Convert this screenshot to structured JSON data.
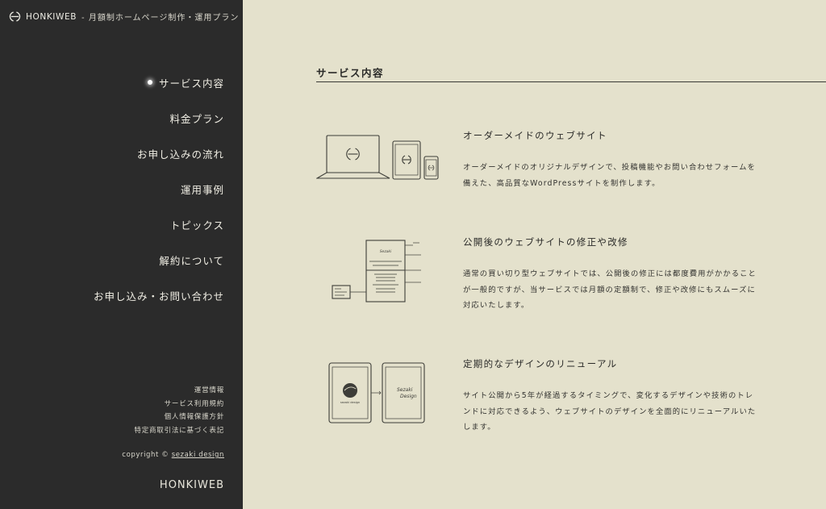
{
  "header": {
    "brand_name": "HONKIWEB",
    "brand_tagline": "- 月額制ホームページ制作・運用プラン"
  },
  "sidebar": {
    "nav": [
      {
        "label": "サービス内容",
        "active": true
      },
      {
        "label": "料金プラン",
        "active": false
      },
      {
        "label": "お申し込みの流れ",
        "active": false
      },
      {
        "label": "運用事例",
        "active": false
      },
      {
        "label": "トピックス",
        "active": false
      },
      {
        "label": "解約について",
        "active": false
      },
      {
        "label": "お申し込み・お問い合わせ",
        "active": false
      }
    ],
    "footer_links": [
      "運営情報",
      "サービス利用規約",
      "個人情報保護方針",
      "特定商取引法に基づく表記"
    ],
    "copyright_prefix": "copyright ©",
    "copyright_link": "sezaki design",
    "footer_logo": "HONKIWEB"
  },
  "main": {
    "section_title": "サービス内容",
    "services": [
      {
        "title": "オーダーメイドのウェブサイト",
        "body": "オーダーメイドのオリジナルデザインで、投稿機能やお問い合わせフォームを備えた、高品質なWordPressサイトを制作します。",
        "icon": "devices-illustration"
      },
      {
        "title": "公開後のウェブサイトの修正や改修",
        "body": "通常の買い切り型ウェブサイトでは、公開後の修正には都度費用がかかることが一般的ですが、当サービスでは月額の定額制で、修正や改修にもスムーズに対応いたします。",
        "icon": "site-revision-illustration"
      },
      {
        "title": "定期的なデザインのリニューアル",
        "body": "サイト公開から5年が経過するタイミングで、変化するデザインや技術のトレンドに対応できるよう、ウェブサイトのデザインを全面的にリニューアルいたします。",
        "icon": "renewal-illustration"
      }
    ],
    "illustration_text": {
      "page_heading": "Sezaki",
      "old_logo": "sezaki design",
      "new_logo_line1": "Sezaki",
      "new_logo_line2": "Design"
    }
  },
  "colors": {
    "sidebar_bg": "#2b2b2b",
    "content_bg": "#e4e1cc",
    "text_dark": "#2a2a28",
    "text_light": "#f0eee4"
  }
}
